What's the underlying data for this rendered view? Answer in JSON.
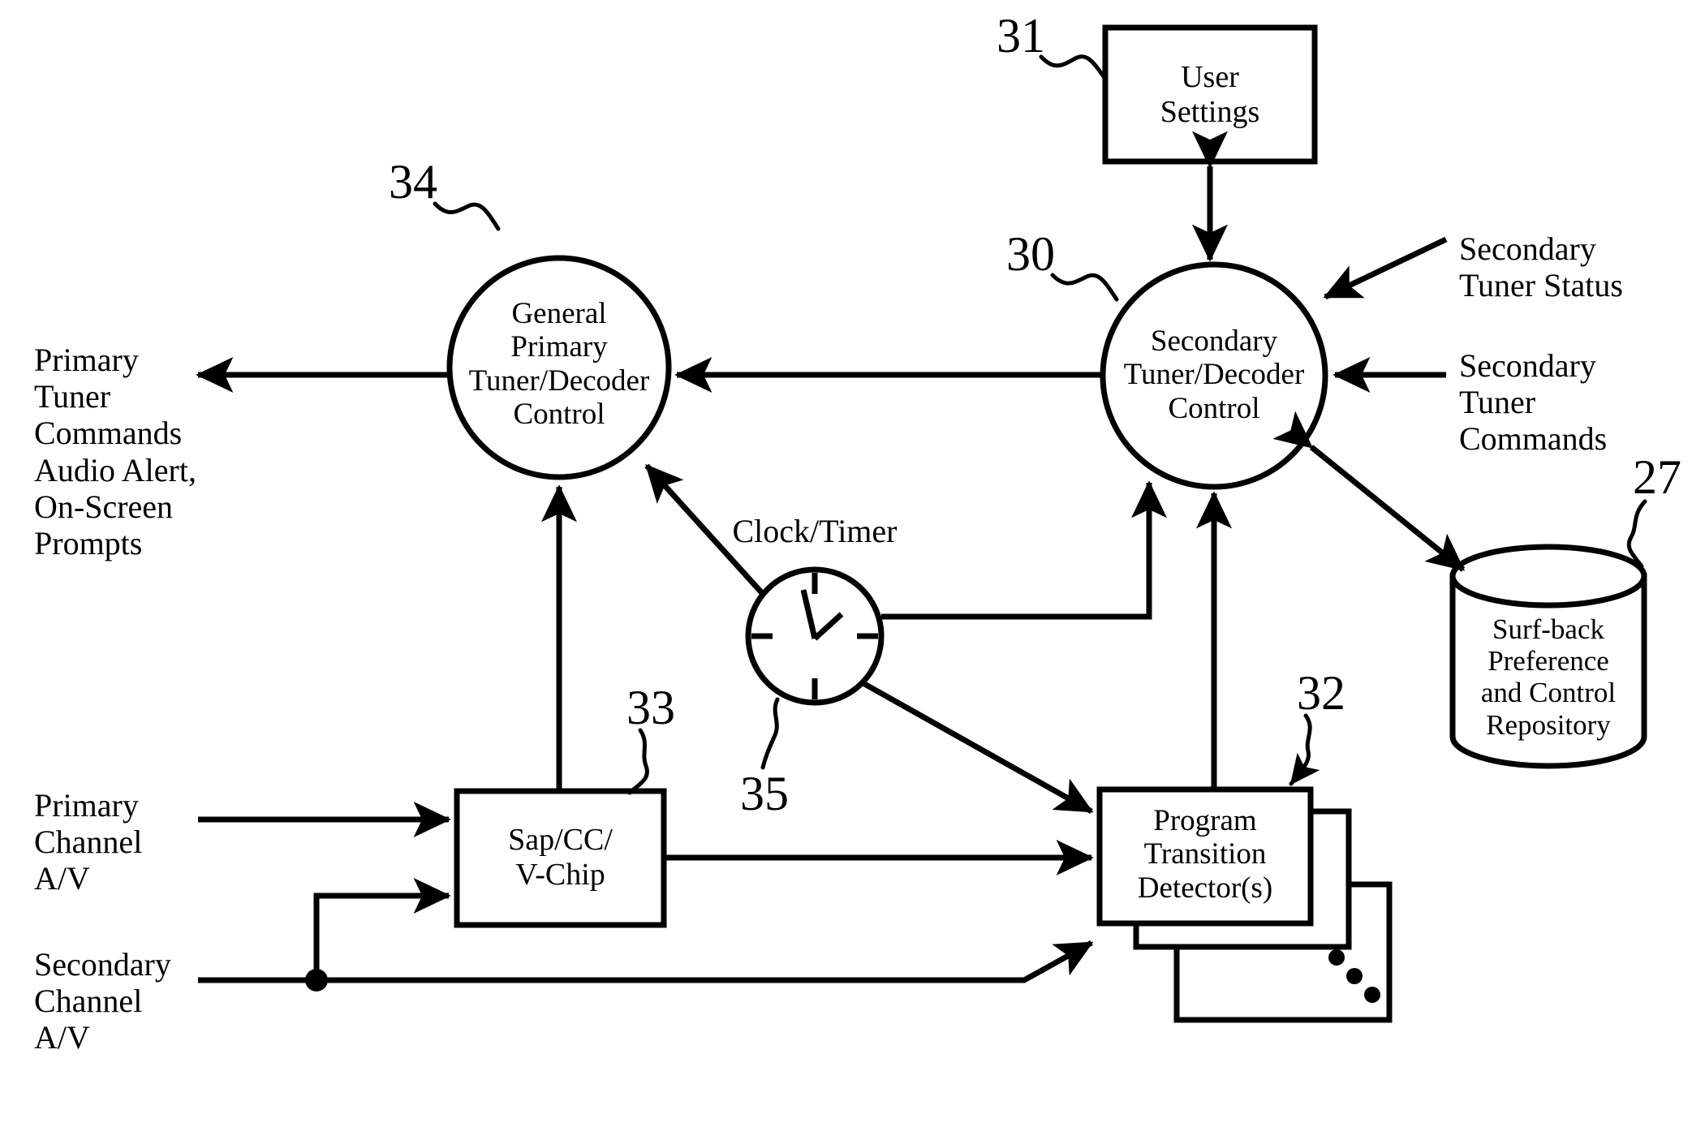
{
  "figure": {
    "title": "Surf-back tuner control block diagram",
    "background_color": "#ffffff",
    "line_color": "#000000"
  },
  "nodes": {
    "user_settings": {
      "label": "User\nSettings",
      "ref": "31",
      "shape": "rectangle"
    },
    "general_primary": {
      "label": "General\nPrimary\nTuner/Decoder\nControl",
      "ref": "34",
      "shape": "circle"
    },
    "secondary_control": {
      "label": "Secondary\nTuner/Decoder\nControl",
      "ref": "30",
      "shape": "circle"
    },
    "clock_timer": {
      "label": "Clock/Timer",
      "ref": "35",
      "shape": "clock"
    },
    "sap_cc_vchip": {
      "label": "Sap/CC/\nV-Chip",
      "ref": "33",
      "shape": "rectangle"
    },
    "program_transition_detector": {
      "label": "Program\nTransition\nDetector(s)",
      "ref": "32",
      "shape": "stacked-rectangle"
    },
    "surfback_repository": {
      "label": "Surf-back\nPreference\nand Control\nRepository",
      "ref": "27",
      "shape": "cylinder"
    }
  },
  "io_labels": {
    "primary_tuner_commands": "Primary\nTuner\nCommands\nAudio Alert,\nOn-Screen\nPrompts",
    "secondary_tuner_status": "Secondary\nTuner Status",
    "secondary_tuner_commands": "Secondary\nTuner\nCommands",
    "primary_channel_av": "Primary\nChannel\nA/V",
    "secondary_channel_av": "Secondary\nChannel\nA/V"
  },
  "ref_numbers": [
    "27",
    "30",
    "31",
    "32",
    "33",
    "34",
    "35"
  ],
  "connections": [
    {
      "name": "user-settings-to-secondary",
      "from": "user_settings",
      "to": "secondary_control",
      "arrow": "double"
    },
    {
      "name": "secondary-to-general-primary",
      "from": "secondary_control",
      "to": "general_primary",
      "arrow": "single"
    },
    {
      "name": "general-primary-to-output",
      "from": "general_primary",
      "to": "primary_tuner_commands",
      "arrow": "single"
    },
    {
      "name": "secondary-tuner-status-in",
      "from": "secondary_tuner_status",
      "to": "secondary_control",
      "arrow": "single"
    },
    {
      "name": "secondary-tuner-commands-out",
      "from": "secondary_tuner_commands",
      "to": "secondary_control",
      "arrow": "single"
    },
    {
      "name": "secondary-to-repository",
      "from": "secondary_control",
      "to": "surfback_repository",
      "arrow": "double"
    },
    {
      "name": "clock-to-general-primary",
      "from": "clock_timer",
      "to": "general_primary",
      "arrow": "single"
    },
    {
      "name": "clock-to-secondary",
      "from": "clock_timer",
      "to": "secondary_control",
      "arrow": "single"
    },
    {
      "name": "clock-to-detector",
      "from": "clock_timer",
      "to": "program_transition_detector",
      "arrow": "single"
    },
    {
      "name": "sap-to-general-primary",
      "from": "sap_cc_vchip",
      "to": "general_primary",
      "arrow": "single"
    },
    {
      "name": "sap-to-detector",
      "from": "sap_cc_vchip",
      "to": "program_transition_detector",
      "arrow": "single"
    },
    {
      "name": "detector-to-secondary",
      "from": "program_transition_detector",
      "to": "secondary_control",
      "arrow": "single"
    },
    {
      "name": "primary-av-to-sap",
      "from": "primary_channel_av",
      "to": "sap_cc_vchip",
      "arrow": "single"
    },
    {
      "name": "secondary-av-to-sap",
      "from": "secondary_channel_av",
      "to": "sap_cc_vchip",
      "arrow": "single"
    },
    {
      "name": "secondary-av-to-detector",
      "from": "secondary_channel_av",
      "to": "program_transition_detector",
      "arrow": "single"
    }
  ]
}
